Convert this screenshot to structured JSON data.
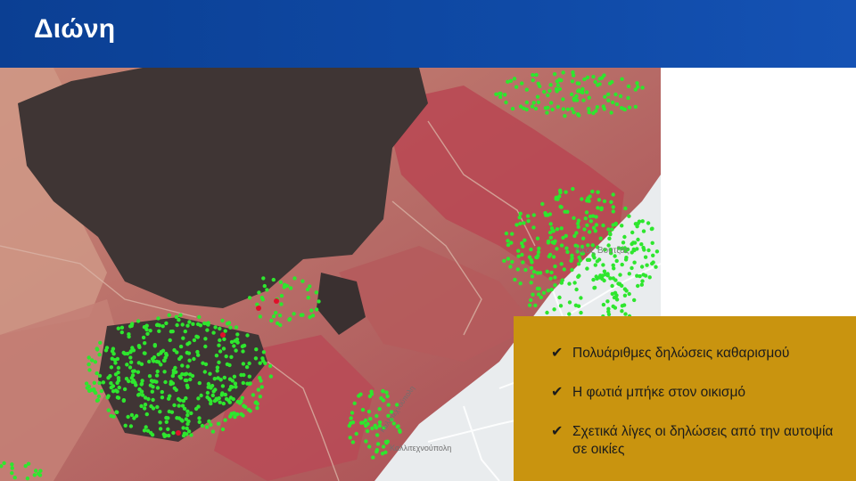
{
  "header": {
    "title": "Διώνη"
  },
  "map": {
    "labels": {
      "place": "Νέος Βουτζάς",
      "street_1": "Καλλιτεχνούπολη",
      "street_2": "Καλλιτεχνούπολη"
    }
  },
  "info_panel": {
    "bullets": [
      {
        "icon": "check-icon",
        "text": "Πολυάριθμες δηλώσεις καθαρισμού"
      },
      {
        "icon": "check-icon",
        "text": "Η φωτιά μπήκε στον οικισμό"
      },
      {
        "icon": "check-icon",
        "text": "Σχετικά λίγες οι δηλώσεις από την αυτοψία σε οικίες"
      }
    ]
  },
  "colors": {
    "header_blue": "#0f4aa6",
    "panel_gold": "#c9940f",
    "burned_area": "#3e3433",
    "vegetation_red": "#b8555d",
    "declaration_dot": "#2ee62e"
  }
}
